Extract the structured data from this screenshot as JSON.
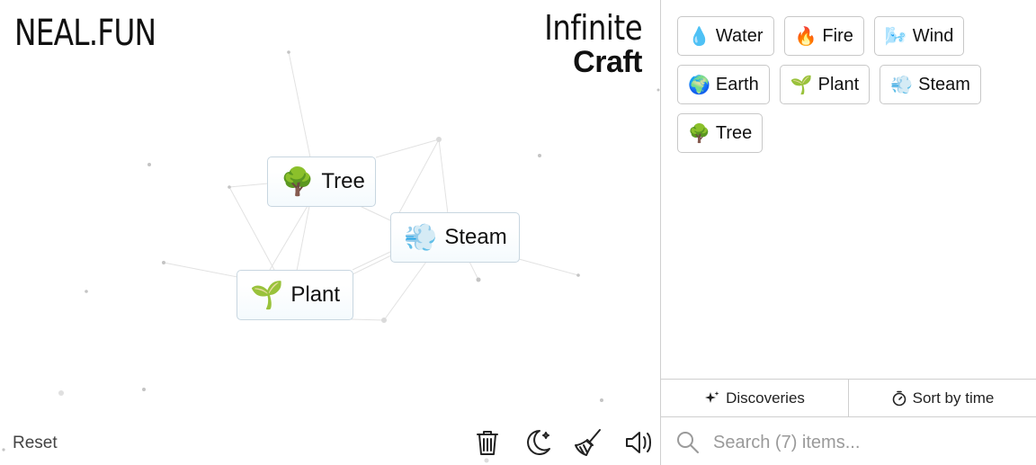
{
  "header": {
    "logo": "NEAL.FUN",
    "title_line1": "Infinite",
    "title_line2": "Craft"
  },
  "canvas_items": [
    {
      "emoji": "🌳",
      "label": "Tree"
    },
    {
      "emoji": "💨",
      "label": "Steam"
    },
    {
      "emoji": "🌱",
      "label": "Plant"
    }
  ],
  "footer": {
    "reset_label": "Reset"
  },
  "tools": [
    "trash-icon",
    "moon-icon",
    "broom-icon",
    "speaker-icon"
  ],
  "sidebar": {
    "items": [
      {
        "emoji": "💧",
        "label": "Water"
      },
      {
        "emoji": "🔥",
        "label": "Fire"
      },
      {
        "emoji": "🌬️",
        "label": "Wind"
      },
      {
        "emoji": "🌍",
        "label": "Earth"
      },
      {
        "emoji": "🌱",
        "label": "Plant"
      },
      {
        "emoji": "💨",
        "label": "Steam"
      },
      {
        "emoji": "🌳",
        "label": "Tree"
      }
    ],
    "tabs": [
      {
        "icon": "sparkles-icon",
        "label": "Discoveries"
      },
      {
        "icon": "stopwatch-icon",
        "label": "Sort by time"
      }
    ],
    "search_placeholder": "Search (7) items..."
  }
}
